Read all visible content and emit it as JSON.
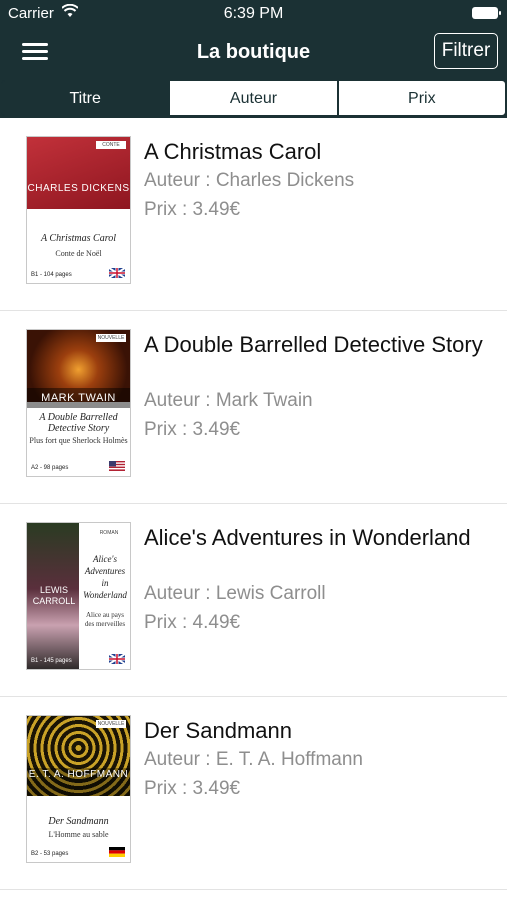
{
  "status_bar": {
    "carrier": "Carrier",
    "time": "6:39 PM"
  },
  "nav": {
    "title": "La boutique",
    "filter_label": "Filtrer"
  },
  "segments": [
    {
      "label": "Titre",
      "active": true
    },
    {
      "label": "Auteur",
      "active": false
    },
    {
      "label": "Prix",
      "active": false
    }
  ],
  "colors": {
    "header_bg": "#1b3134",
    "secondary_text": "#8e8e8e"
  },
  "books": [
    {
      "title": "A Christmas Carol",
      "author_line": "Auteur : Charles Dickens",
      "price_line": "Prix : 3.49€",
      "cover": {
        "tag": "CONTE",
        "author": "CHARLES DICKENS",
        "title": "A Christmas Carol",
        "subtitle": "Conte de Noël",
        "pages": "B1 - 104 pages",
        "flag": "uk-flag-icon"
      }
    },
    {
      "title": "A Double Barrelled Detective Story",
      "author_line": "Auteur : Mark Twain",
      "price_line": "Prix : 3.49€",
      "cover": {
        "tag": "NOUVELLE",
        "author": "MARK TWAIN",
        "title": "A Double Barrelled Detective Story",
        "subtitle": "Plus fort que Sherlock Holmès",
        "pages": "A2 - 98 pages",
        "flag": "us-flag-icon"
      }
    },
    {
      "title": "Alice's Adventures in Wonderland",
      "author_line": "Auteur : Lewis Carroll",
      "price_line": "Prix : 4.49€",
      "cover": {
        "tag": "ROMAN",
        "author": "LEWIS CARROLL",
        "title": "Alice's Adventures in Wonderland",
        "subtitle": "Alice au pays des merveilles",
        "pages": "B1 - 145 pages",
        "flag": "uk-flag-icon"
      }
    },
    {
      "title": "Der Sandmann",
      "author_line": "Auteur : E. T. A. Hoffmann",
      "price_line": "Prix : 3.49€",
      "cover": {
        "tag": "NOUVELLE",
        "author": "E. T. A. HOFFMANN",
        "title": "Der Sandmann",
        "subtitle": "L'Homme au sable",
        "pages": "B2 - 53 pages",
        "flag": "de-flag-icon"
      }
    }
  ]
}
